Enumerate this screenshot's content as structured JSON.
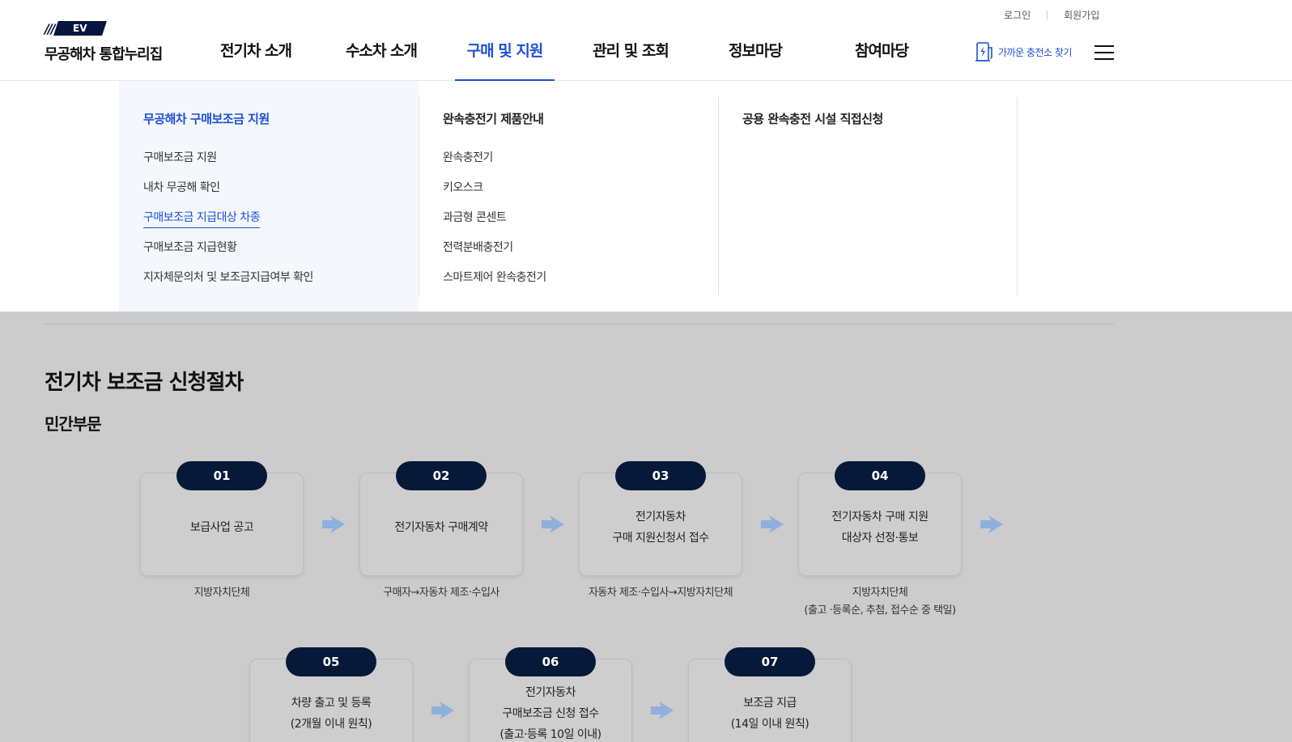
{
  "header": {
    "login": "로그인",
    "signup": "회원가입",
    "logo_badge": "EV",
    "logo_text": "무공해차 통합누리집",
    "nav": [
      "전기차 소개",
      "수소차 소개",
      "구매 및 지원",
      "관리 및 조회",
      "정보마당",
      "참여마당"
    ],
    "active_nav": "구매 및 지원",
    "charger_label": "가까운 충전소 찾기",
    "accent_color": "#1d4fd8",
    "navy_color": "#071939"
  },
  "mega_menu": {
    "columns": [
      {
        "title": "무공해차 구매보조금 지원",
        "items": [
          "구매보조금 지원",
          "내차 무공해 확인",
          "구매보조금 지급대상 차종",
          "구매보조금 지급현황",
          "지자체문의처 및 보조금지급여부 확인"
        ],
        "current": "구매보조금 지급대상 차종"
      },
      {
        "title": "완속충전기 제품안내",
        "items": [
          "완속충전기",
          "키오스크",
          "과금형 콘센트",
          "전력분배충전기",
          "스마트제어 완속충전기"
        ]
      },
      {
        "title": "공용 완속충전 시설 직접신청",
        "items": []
      }
    ]
  },
  "page": {
    "title": "전기차 보조금 신청절차",
    "subtitle": "민간부문",
    "steps": [
      {
        "num": "01",
        "text": "보급사업 공고",
        "actor": "지방자치단체"
      },
      {
        "num": "02",
        "text": "전기자동차 구매계약",
        "actor": "구매자→자동차 제조·수입사"
      },
      {
        "num": "03",
        "text": "전기자동차\n구매 지원신청서 접수",
        "actor": "자동차 제조·수입사→지방자치단체"
      },
      {
        "num": "04",
        "text": "전기자동차 구매 지원\n대상자 선정·통보",
        "actor": "지방자치단체\n(출고 ·등록순, 추첨, 접수순 중 택일)"
      },
      {
        "num": "05",
        "text": "차량 출고 및 등록\n(2개월 이내 원칙)",
        "actor": ""
      },
      {
        "num": "06",
        "text": "전기자동차\n구매보조금 신청 접수\n(출고·등록 10일 이내)",
        "actor": ""
      },
      {
        "num": "07",
        "text": "보조금 지급\n(14일 이내 원칙)",
        "actor": ""
      }
    ]
  }
}
